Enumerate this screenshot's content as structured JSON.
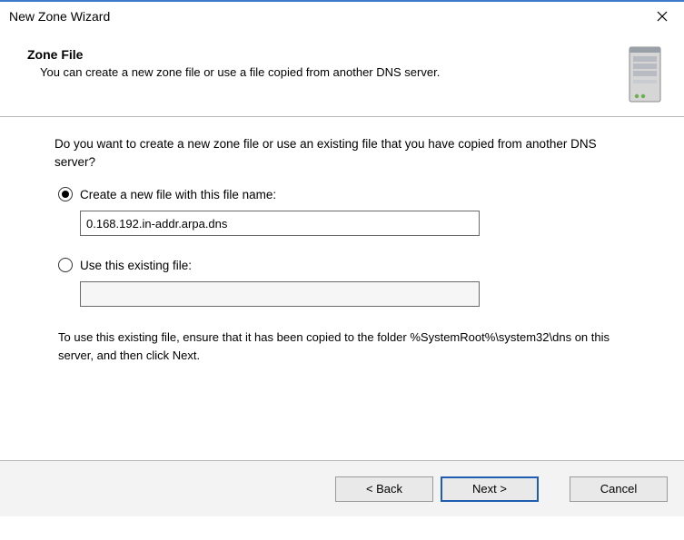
{
  "window": {
    "title": "New Zone Wizard"
  },
  "header": {
    "title": "Zone File",
    "description": "You can create a new zone file or use a file copied from another DNS server."
  },
  "body": {
    "prompt": "Do you want to create a new zone file or use an existing file that you have copied from another DNS server?",
    "option_create_label": "Create a new file with this file name:",
    "create_file_value": "0.168.192.in-addr.arpa.dns",
    "option_existing_label": "Use this existing file:",
    "existing_file_value": "",
    "hint": "To use this existing file, ensure that it has been copied to the folder %SystemRoot%\\system32\\dns on this server, and then click Next."
  },
  "footer": {
    "back_label": "< Back",
    "next_label": "Next >",
    "cancel_label": "Cancel"
  }
}
